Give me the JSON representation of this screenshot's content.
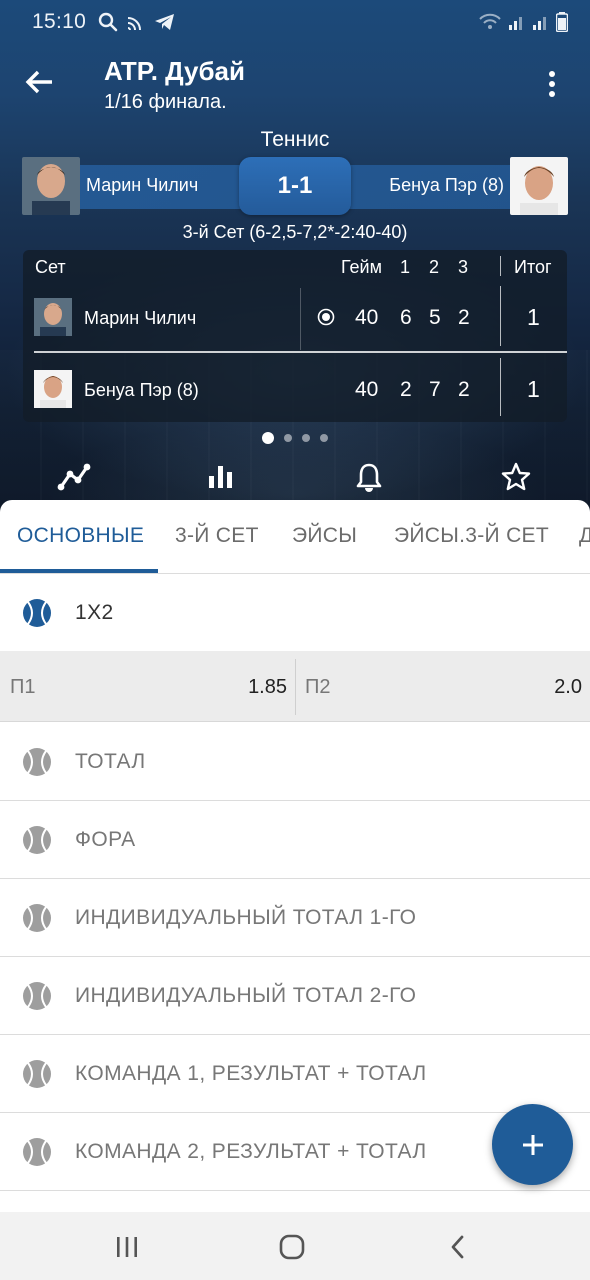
{
  "status_bar": {
    "time": "15:10",
    "left_icons": [
      "search-icon",
      "cast-icon",
      "telegram-icon"
    ],
    "right_icons": [
      "wifi-icon",
      "signal-icon",
      "signal-icon",
      "battery-icon"
    ]
  },
  "header": {
    "title": "ATP. Дубай",
    "subtitle": "1/16 финала.",
    "sport": "Теннис"
  },
  "match": {
    "player1": "Марин Чилич",
    "player2": "Бенуа Пэр (8)",
    "score": "1-1",
    "set_info": "3-й Сет (6-2,5-7,2*-2:40-40)"
  },
  "scoreboard": {
    "headers": {
      "set": "Сет",
      "game": "Гейм",
      "c1": "1",
      "c2": "2",
      "c3": "3",
      "total": "Итог"
    },
    "rows": [
      {
        "name": "Марин Чилич",
        "game": "40",
        "s1": "6",
        "s2": "5",
        "s3": "2",
        "total": "1",
        "serving": true
      },
      {
        "name": "Бенуа Пэр (8)",
        "game": "40",
        "s1": "2",
        "s2": "7",
        "s3": "2",
        "total": "1",
        "serving": false
      }
    ]
  },
  "pager": {
    "count": 4,
    "active": 1
  },
  "actions": [
    "line-chart-icon",
    "bar-chart-icon",
    "bell-icon",
    "star-icon"
  ],
  "tabs": [
    "ОСНОВНЫЕ",
    "3-Й СЕТ",
    "ЭЙСЫ",
    "ЭЙСЫ.3-Й СЕТ",
    "Д"
  ],
  "active_tab": 0,
  "markets": {
    "open": {
      "label": "1X2"
    },
    "odds": [
      {
        "label": "П1",
        "value": "1.85"
      },
      {
        "label": "П2",
        "value": "2.0"
      }
    ],
    "list": [
      "ТОТАЛ",
      "ФОРА",
      "ИНДИВИДУАЛЬНЫЙ ТОТАЛ 1-ГО",
      "ИНДИВИДУАЛЬНЫЙ ТОТАЛ 2-ГО",
      "КОМАНДА 1, РЕЗУЛЬТАТ + ТОТАЛ",
      "КОМАНДА 2, РЕЗУЛЬТАТ + ТОТАЛ"
    ]
  },
  "colors": {
    "primary": "#1f5c98",
    "header_top": "#1c4a7a",
    "odds_bg": "#ececec"
  }
}
